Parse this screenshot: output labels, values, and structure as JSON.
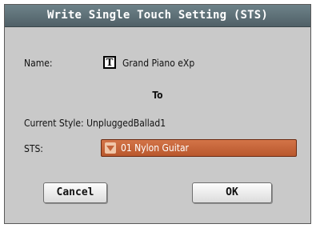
{
  "dialog": {
    "title": "Write Single Touch Setting (STS)",
    "name_label": "Name:",
    "name_icon": "text-T-icon",
    "name_value": "Grand Piano eXp",
    "to_label": "To",
    "current_style_label": "Current Style:",
    "current_style_value": "UnpluggedBallad1",
    "sts_label": "STS:",
    "sts_selected": "01 Nylon Guitar",
    "cancel_label": "Cancel",
    "ok_label": "OK"
  },
  "colors": {
    "dialog_bg": "#c9c9c9",
    "titlebar": "#5f7279",
    "select_accent": "#c5643a"
  }
}
